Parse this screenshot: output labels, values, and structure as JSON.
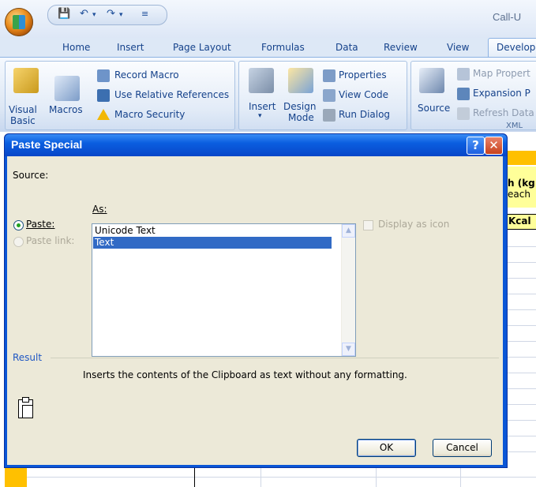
{
  "app": {
    "title_partial": "Call-U"
  },
  "qat": {
    "save_icon": "save-icon",
    "undo_icon": "undo-icon",
    "redo_icon": "redo-icon"
  },
  "tabs": [
    {
      "label": "Home"
    },
    {
      "label": "Insert"
    },
    {
      "label": "Page Layout"
    },
    {
      "label": "Formulas"
    },
    {
      "label": "Data"
    },
    {
      "label": "Review"
    },
    {
      "label": "View"
    },
    {
      "label": "Develop"
    }
  ],
  "ribbon": {
    "code": {
      "visual_basic_line1": "Visual",
      "visual_basic_line2": "Basic",
      "macros": "Macros",
      "record_macro": "Record Macro",
      "use_relative": "Use Relative References",
      "macro_security": "Macro Security"
    },
    "controls": {
      "insert": "Insert",
      "design_line1": "Design",
      "design_line2": "Mode",
      "properties": "Properties",
      "view_code": "View Code",
      "run_dialog": "Run Dialog"
    },
    "xml": {
      "source": "Source",
      "map_properties": "Map Propert",
      "expansion": "Expansion P",
      "refresh": "Refresh Data",
      "group_label": "XML"
    }
  },
  "sheet": {
    "header_text1": "h (kg",
    "header_text2": "each",
    "header_text3": "Kcal"
  },
  "dialog": {
    "title": "Paste Special",
    "source_label": "Source:",
    "as_label": "As:",
    "paste_label": "Paste:",
    "paste_link_label": "Paste link:",
    "formats": [
      "Unicode Text",
      "Text"
    ],
    "selected_format": "Text",
    "display_as_icon": "Display as icon",
    "result_label": "Result",
    "result_text": "Inserts the contents of the Clipboard as text without any formatting.",
    "ok": "OK",
    "cancel": "Cancel",
    "help_glyph": "?",
    "close_glyph": "✕"
  },
  "colors": {
    "titlebar_blue": "#0a56d6",
    "selection": "#316ac5",
    "dialog_bg": "#ece9d8"
  }
}
